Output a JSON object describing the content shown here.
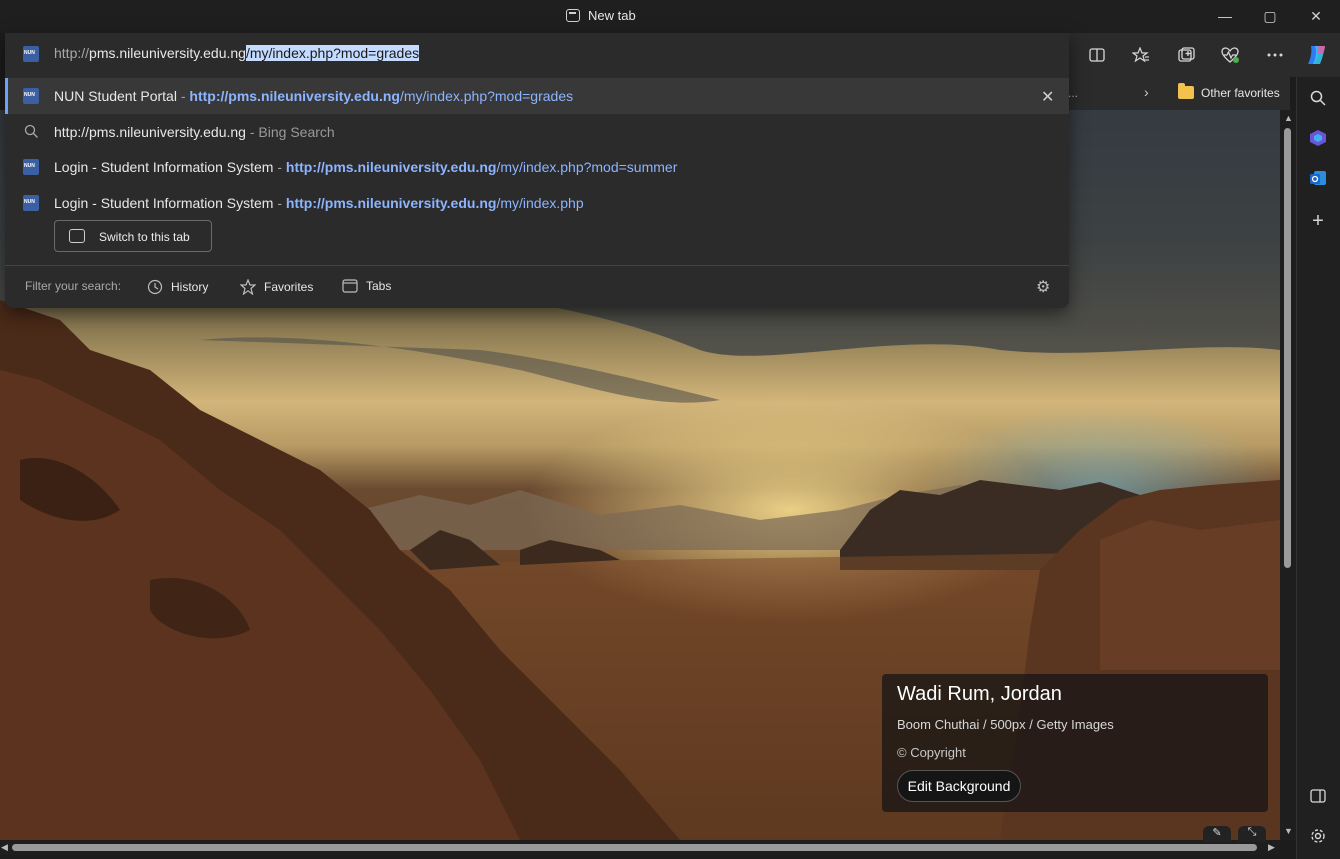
{
  "window": {
    "tab_title": "New tab",
    "minimize_glyph": "—",
    "maximize_glyph": "▢",
    "close_glyph": "✕"
  },
  "address_bar": {
    "scheme": "http://",
    "host": "pms.nileuniversity.edu.ng",
    "selected_path": "/my/index.php?mod=grades"
  },
  "suggestions": [
    {
      "title": "NUN Student Portal",
      "separator": " - ",
      "url_bold": "http://pms.nileuniversity.edu.ng",
      "url_rest": "/my/index.php?mod=grades"
    },
    {
      "query": "http://pms.nileuniversity.edu.ng",
      "separator": " - ",
      "engine": "Bing Search"
    },
    {
      "title": "Login - Student Information System",
      "separator": " - ",
      "url_bold": "http://pms.nileuniversity.edu.ng",
      "url_rest": "/my/index.php?mod=summer"
    },
    {
      "title": "Login - Student Information System",
      "separator": " - ",
      "url_bold": "http://pms.nileuniversity.edu.ng",
      "url_rest": "/my/index.php"
    }
  ],
  "switch_tab_label": "Switch to this tab",
  "filter": {
    "label": "Filter your search:",
    "history": "History",
    "favorites": "Favorites",
    "tabs": "Tabs"
  },
  "favorites_bar": {
    "overflow": "...",
    "other_favorites": "Other favorites"
  },
  "background_info": {
    "location": "Wadi Rum, Jordan",
    "credit": "Boom Chuthai / 500px / Getty Images",
    "copyright": "© Copyright",
    "edit_label": "Edit Background"
  },
  "colors": {
    "accent": "#6aa2ff",
    "url_blue": "#8cb4ff",
    "selection": "#c4daff"
  }
}
